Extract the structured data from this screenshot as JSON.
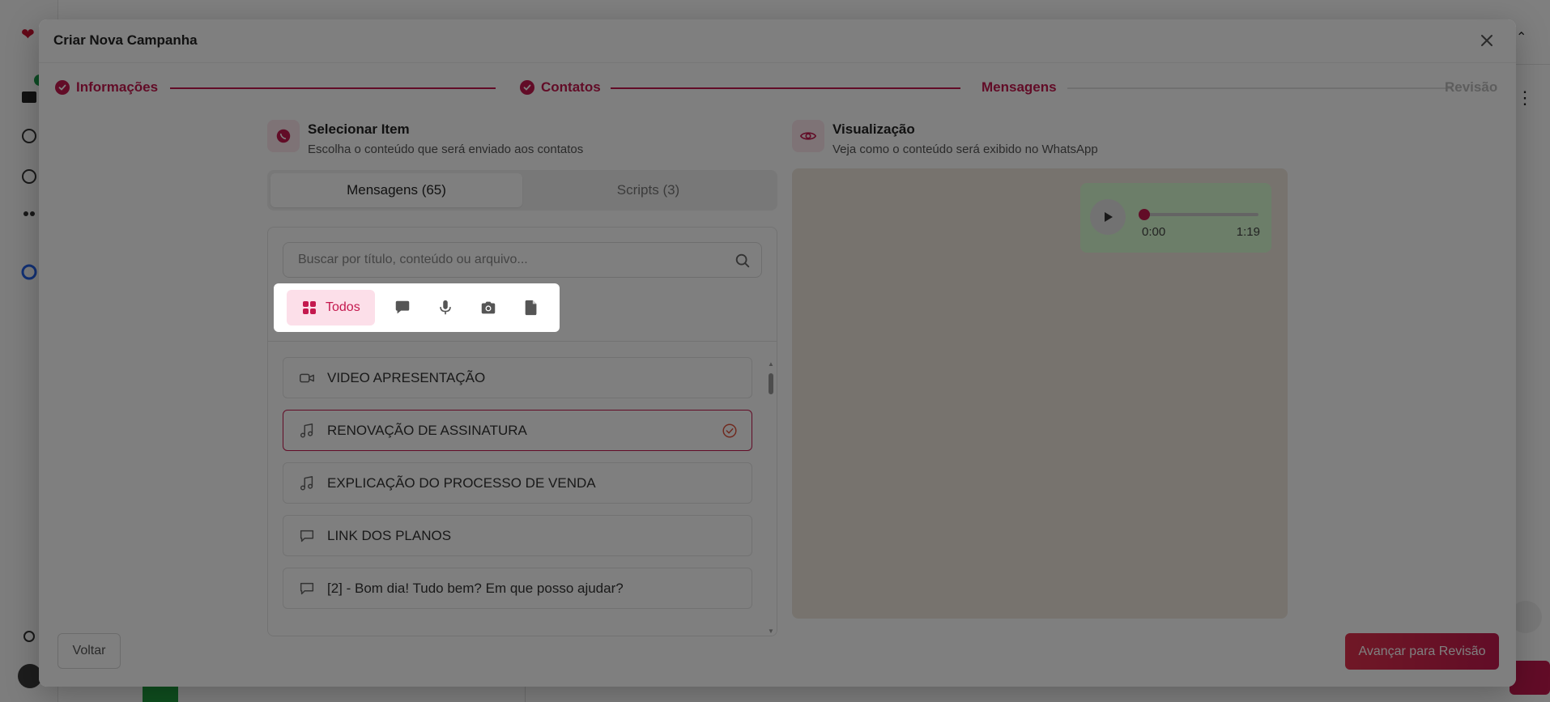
{
  "modal": {
    "title": "Criar Nova Campanha"
  },
  "stepper": {
    "steps": [
      {
        "label": "Informações",
        "state": "done"
      },
      {
        "label": "Contatos",
        "state": "done"
      },
      {
        "label": "Mensagens",
        "state": "current"
      },
      {
        "label": "Revisão",
        "state": "pending"
      }
    ]
  },
  "select_panel": {
    "title": "Selecionar Item",
    "subtitle": "Escolha o conteúdo que será enviado aos contatos",
    "icon": "whatsapp-icon",
    "tabs": [
      {
        "label": "Mensagens (65)",
        "active": true
      },
      {
        "label": "Scripts (3)",
        "active": false
      }
    ],
    "search": {
      "placeholder": "Buscar por título, conteúdo ou arquivo...",
      "value": ""
    },
    "filters": {
      "all_label": "Todos",
      "icons": [
        "message-icon",
        "microphone-icon",
        "camera-icon",
        "document-icon"
      ]
    },
    "items": [
      {
        "label": "VIDEO APRESENTAÇÃO",
        "icon": "video-icon",
        "selected": false
      },
      {
        "label": "RENOVAÇÃO DE ASSINATURA",
        "icon": "music-icon",
        "selected": true
      },
      {
        "label": "EXPLICAÇÃO DO PROCESSO DE VENDA",
        "icon": "music-icon",
        "selected": false
      },
      {
        "label": "LINK DOS PLANOS",
        "icon": "message-icon",
        "selected": false
      },
      {
        "label": "[2] - Bom dia! Tudo bem? Em que posso ajudar?",
        "icon": "message-icon",
        "selected": false
      }
    ]
  },
  "preview_panel": {
    "title": "Visualização",
    "subtitle": "Veja como o conteúdo será exibido no WhatsApp",
    "icon": "eye-icon",
    "audio": {
      "current_time": "0:00",
      "duration": "1:19",
      "progress": 0
    }
  },
  "footer": {
    "back_label": "Voltar",
    "next_label": "Avançar para Revisão"
  },
  "colors": {
    "accent": "#c4194e",
    "accent_light": "#fcdfe9",
    "chat_bg": "#efe6dc",
    "bubble": "#d9fdd3"
  }
}
